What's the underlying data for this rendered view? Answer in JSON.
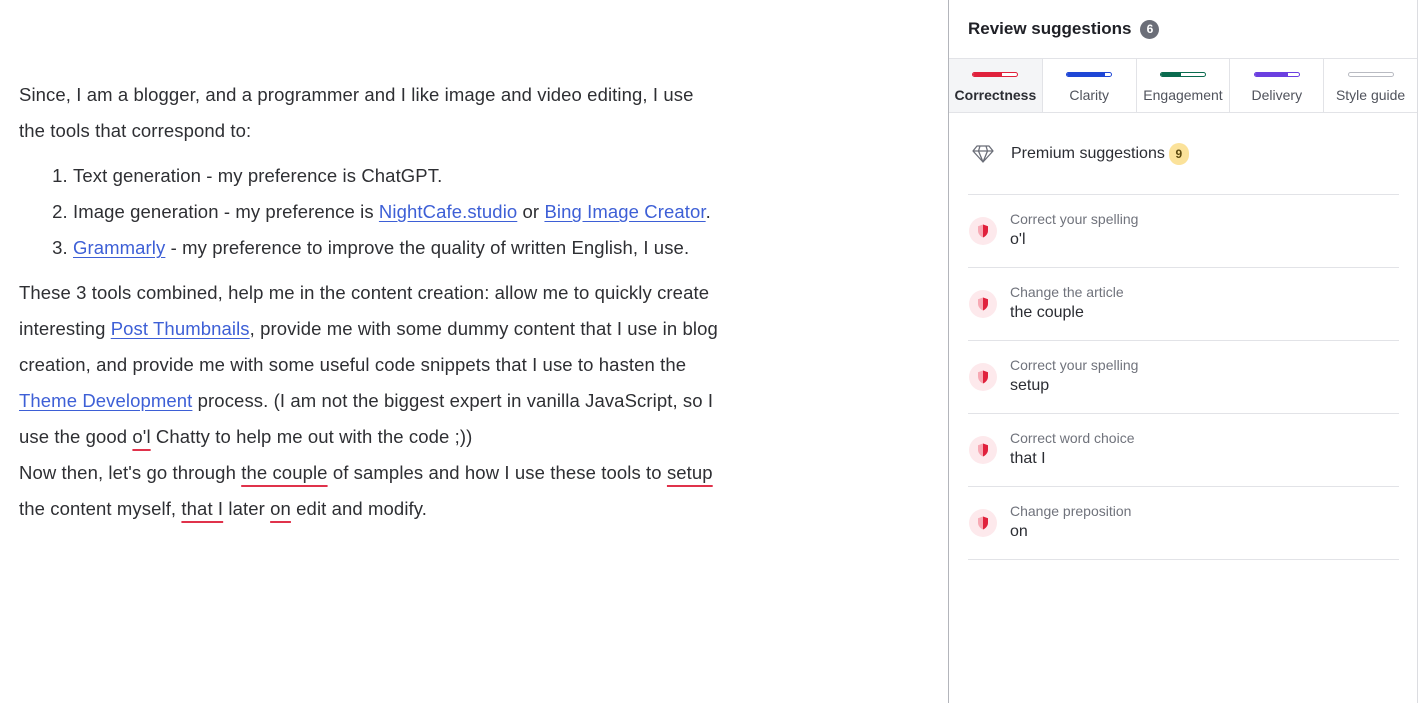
{
  "editor": {
    "intro_line": "Since, I am a blogger, and a programmer and I like image and video editing, I use the tools that correspond to:",
    "list": {
      "item1": {
        "text": "Text generation - my preference is ChatGPT."
      },
      "item2": {
        "prefix": "Image generation - my preference is ",
        "link1": "NightCafe.studio",
        "middle": " or ",
        "link2": "Bing Image Creator",
        "suffix": "."
      },
      "item3": {
        "link": "Grammarly",
        "suffix": " - my preference to improve the quality of written English, I use."
      }
    },
    "para2": {
      "t1": "These 3 tools combined, help me in the content creation: allow me to quickly create interesting ",
      "link1": "Post Thumbnails",
      "t2": ", provide me with some dummy content that I use in blog creation, and provide me with some useful code snippets that I use to hasten the ",
      "link2": "Theme Development",
      "t3": " process. (I am not the biggest expert in vanilla JavaScript, so I use the good ",
      "flag1": "o'l",
      "t4": " Chatty to help me out with the code ;))"
    },
    "para3": {
      "t1": "Now then, let's go through ",
      "flag1": "the couple",
      "t2": " of samples and how I use these tools to ",
      "flag2": "setup",
      "t3": " the content myself, ",
      "flag3": "that I",
      "t4": " later ",
      "flag4": "on",
      "t5": " edit and modify."
    }
  },
  "sidebar": {
    "title": "Review suggestions",
    "count": "6",
    "tabs": [
      {
        "label": "Correctness",
        "color": "#e0213c",
        "progress": 0.65,
        "active": true
      },
      {
        "label": "Clarity",
        "color": "#1f47d6",
        "progress": 0.85,
        "active": false
      },
      {
        "label": "Engagement",
        "color": "#0a6b4f",
        "progress": 0.45,
        "active": false
      },
      {
        "label": "Delivery",
        "color": "#6b3fe0",
        "progress": 0.75,
        "active": false
      },
      {
        "label": "Style guide",
        "color": "#b9bbc2",
        "progress": 0.0,
        "active": false
      }
    ],
    "premium": {
      "label": "Premium suggestions",
      "count": "9",
      "icon": "diamond-icon"
    },
    "suggestions": [
      {
        "type": "Correct your spelling",
        "word": "o'l",
        "icon": "shield-icon"
      },
      {
        "type": "Change the article",
        "word": "the couple",
        "icon": "shield-icon"
      },
      {
        "type": "Correct your spelling",
        "word": "setup",
        "icon": "shield-icon"
      },
      {
        "type": "Correct word choice",
        "word": "that I",
        "icon": "shield-icon"
      },
      {
        "type": "Change preposition",
        "word": "on",
        "icon": "shield-icon"
      }
    ]
  }
}
